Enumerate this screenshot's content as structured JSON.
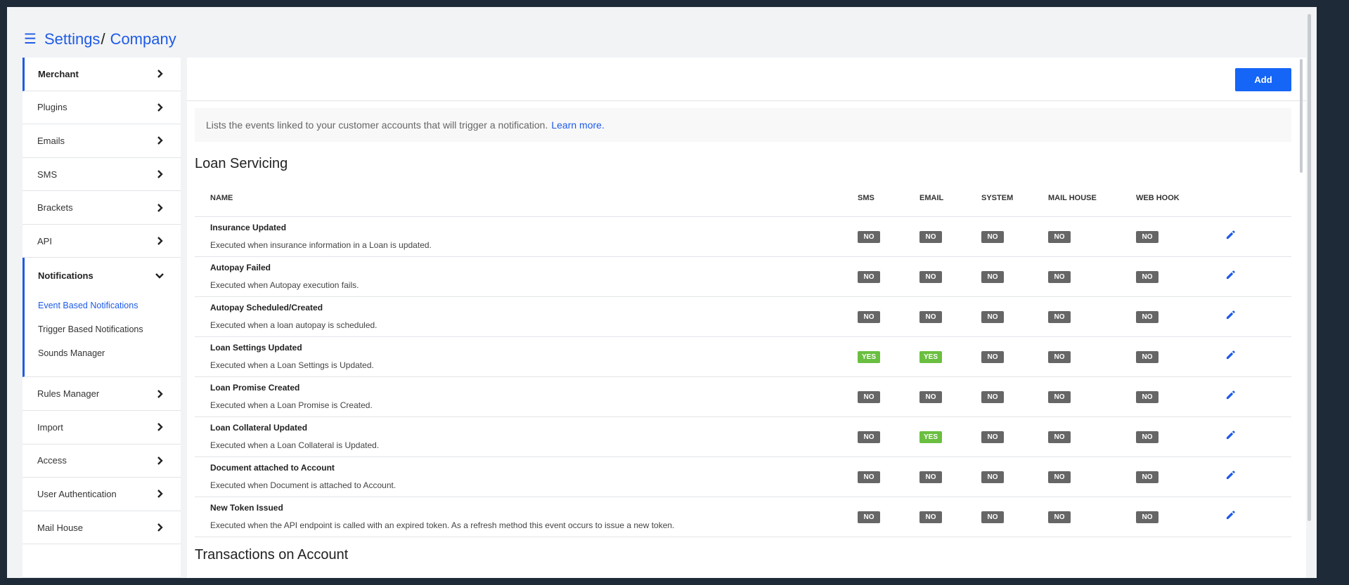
{
  "breadcrumb": {
    "icon": "menu-icon",
    "parent": "Settings",
    "separator": "/",
    "current": "Company"
  },
  "sidebar": {
    "items_top": [
      {
        "label": "Merchant"
      },
      {
        "label": "Plugins"
      },
      {
        "label": "Emails"
      },
      {
        "label": "SMS"
      },
      {
        "label": "Brackets"
      },
      {
        "label": "API"
      }
    ],
    "notifications": {
      "label": "Notifications",
      "subitems": [
        {
          "label": "Event Based Notifications"
        },
        {
          "label": "Trigger Based Notifications"
        },
        {
          "label": "Sounds Manager"
        }
      ]
    },
    "items_bottom": [
      {
        "label": "Rules Manager"
      },
      {
        "label": "Import"
      },
      {
        "label": "Access"
      },
      {
        "label": "User Authentication"
      },
      {
        "label": "Mail House"
      }
    ]
  },
  "toolbar": {
    "add_label": "Add"
  },
  "info": {
    "text": "Lists the events linked to your customer accounts that will trigger a notification.",
    "link": "Learn more."
  },
  "sections": [
    {
      "title": "Loan Servicing"
    },
    {
      "title": "Transactions on Account"
    }
  ],
  "table": {
    "headers": {
      "name": "NAME",
      "sms": "SMS",
      "email": "EMAIL",
      "system": "SYSTEM",
      "mail_house": "MAIL HOUSE",
      "web_hook": "WEB HOOK"
    },
    "rows": [
      {
        "name": "Insurance Updated",
        "desc": "Executed when insurance information in a Loan is updated.",
        "sms": "NO",
        "email": "NO",
        "system": "NO",
        "mail_house": "NO",
        "web_hook": "NO"
      },
      {
        "name": "Autopay Failed",
        "desc": "Executed when Autopay execution fails.",
        "sms": "NO",
        "email": "NO",
        "system": "NO",
        "mail_house": "NO",
        "web_hook": "NO"
      },
      {
        "name": "Autopay Scheduled/Created",
        "desc": "Executed when a loan autopay is scheduled.",
        "sms": "NO",
        "email": "NO",
        "system": "NO",
        "mail_house": "NO",
        "web_hook": "NO"
      },
      {
        "name": "Loan Settings Updated",
        "desc": "Executed when a Loan Settings is Updated.",
        "sms": "YES",
        "email": "YES",
        "system": "NO",
        "mail_house": "NO",
        "web_hook": "NO"
      },
      {
        "name": "Loan Promise Created",
        "desc": "Executed when a Loan Promise is Created.",
        "sms": "NO",
        "email": "NO",
        "system": "NO",
        "mail_house": "NO",
        "web_hook": "NO"
      },
      {
        "name": "Loan Collateral Updated",
        "desc": "Executed when a Loan Collateral is Updated.",
        "sms": "NO",
        "email": "YES",
        "system": "NO",
        "mail_house": "NO",
        "web_hook": "NO"
      },
      {
        "name": "Document attached to Account",
        "desc": "Executed when Document is attached to Account.",
        "sms": "NO",
        "email": "NO",
        "system": "NO",
        "mail_house": "NO",
        "web_hook": "NO"
      },
      {
        "name": "New Token Issued",
        "desc": "Executed when the API endpoint is called with an expired token. As a refresh method this event occurs to issue a new token.",
        "sms": "NO",
        "email": "NO",
        "system": "NO",
        "mail_house": "NO",
        "web_hook": "NO"
      }
    ]
  },
  "colors": {
    "accent": "#1e5be6",
    "button": "#1565f6",
    "badge_no": "#666666",
    "badge_yes": "#6abf40"
  }
}
